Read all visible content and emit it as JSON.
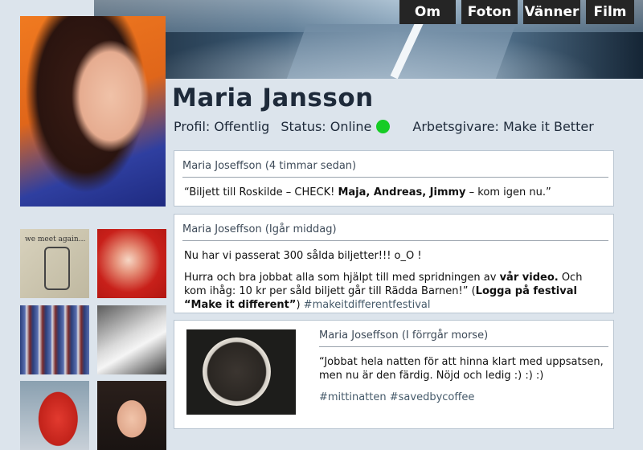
{
  "profile": {
    "name": "Maria Jansson",
    "visibility_label": "Profil: Offentlig",
    "status_label": "Status: Online",
    "status_color": "#16cc25",
    "employer_label": "Arbetsgivare: Make it Better"
  },
  "tabs": [
    {
      "label": "Om"
    },
    {
      "label": "Foton"
    },
    {
      "label": "Vänner"
    },
    {
      "label": "Film"
    }
  ],
  "posts": [
    {
      "header": "Maria Joseffson (4 timmar sedan)",
      "text_a": "“Biljett till Roskilde – CHECK! ",
      "text_bold": "Maja, Andreas, Jimmy",
      "text_b": " – kom igen nu.”"
    },
    {
      "header": "Maria Joseffson (Igår middag)",
      "p1": "Nu har vi passerat 300 sålda biljetter!!! o_O !",
      "p2_a": "Hurra och bra jobbat alla som hjälpt till med spridningen av ",
      "p2_bold1": "vår video.",
      "p2_b": " Och kom ihåg: 10 kr per såld biljett går till Rädda Barnen!” (",
      "p2_bold2": "Logga på festival “Make it different”",
      "p2_c": ") ",
      "p2_tag": "#makeitdifferentfestival"
    },
    {
      "header": "Maria Joseffson (I förrgår morse)",
      "p1": "“Jobbat hela natten för att hinna klart med uppsatsen, men nu är den färdig. Nöjd och ledig :) :) :)",
      "tags": "#mittinatten #savedbycoffee"
    }
  ],
  "photos": [
    {
      "icon": "sketch-note-photo",
      "caption": "we meet again..."
    },
    {
      "icon": "red-drink-photo"
    },
    {
      "icon": "drinks-shelf-photo"
    },
    {
      "icon": "sneakers-photo"
    },
    {
      "icon": "strawberry-photo"
    },
    {
      "icon": "smiling-girl-photo"
    }
  ]
}
